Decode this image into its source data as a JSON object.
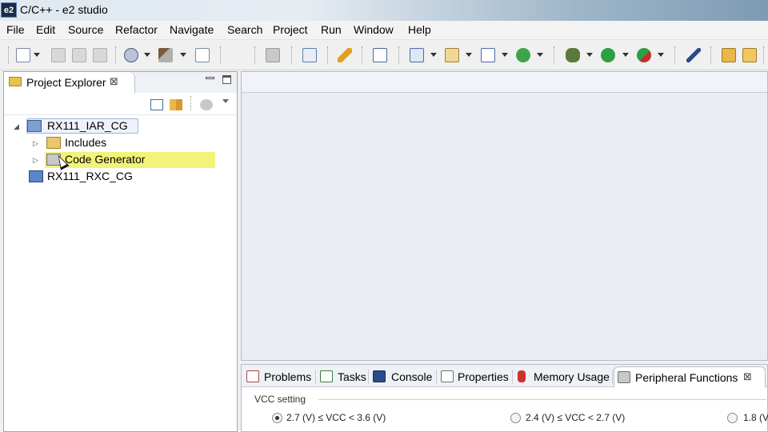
{
  "window": {
    "app_icon": "e2",
    "title": "C/C++ - e2 studio"
  },
  "menu": [
    "File",
    "Edit",
    "Source",
    "Refactor",
    "Navigate",
    "Search",
    "Project",
    "Run",
    "Window",
    "Help"
  ],
  "toolbar_icons": [
    "new-icon",
    "save-icon",
    "save-all-icon",
    "print-icon",
    "target-icon",
    "build-hammer-icon",
    "binary-icon",
    "link-icon",
    "c-file-icon",
    "pencil-icon",
    "task-icon",
    "new-c-project-icon",
    "new-class-icon",
    "new-source-icon",
    "refresh-icon",
    "debug-bug-icon",
    "run-icon",
    "external-tools-icon",
    "pin-icon",
    "open-folder-icon",
    "open-icon"
  ],
  "project_explorer": {
    "tab_label": "Project Explorer",
    "close_glyph": "⊠",
    "tree": [
      {
        "label": "RX111_IAR_CG",
        "expanded": true,
        "icon": "project-open-icon",
        "level": 0
      },
      {
        "label": "Includes",
        "expanded": false,
        "icon": "includes-icon",
        "level": 1
      },
      {
        "label": "Code Generator",
        "expanded": false,
        "icon": "code-generator-icon",
        "level": 1,
        "selected": true
      },
      {
        "label": "RX111_RXC_CG",
        "icon": "project-closed-icon",
        "level": 0
      }
    ]
  },
  "bottom_tabs": [
    {
      "label": "Problems",
      "icon": "problems-icon"
    },
    {
      "label": "Tasks",
      "icon": "tasks-icon"
    },
    {
      "label": "Console",
      "icon": "console-icon"
    },
    {
      "label": "Properties",
      "icon": "properties-icon"
    },
    {
      "label": "Memory Usage",
      "icon": "memory-usage-icon"
    },
    {
      "label": "Peripheral Functions",
      "icon": "peripheral-functions-icon",
      "active": true
    }
  ],
  "peripheral": {
    "group_label": "VCC setting",
    "options": [
      {
        "label": "2.7 (V) ≤ VCC < 3.6 (V)",
        "checked": true
      },
      {
        "label": "2.4 (V) ≤ VCC < 2.7 (V)",
        "checked": false
      },
      {
        "label": "1.8 (V",
        "checked": false
      }
    ]
  },
  "colors": {
    "selection_highlight": "#f3f37a",
    "panel_border": "#a0a8b4",
    "editor_bg": "#eaeef3"
  }
}
